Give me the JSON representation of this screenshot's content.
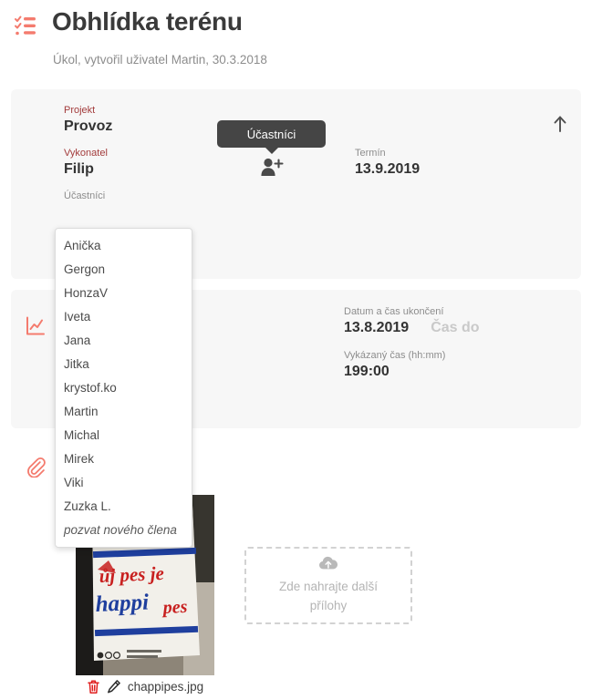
{
  "header": {
    "icon": "checklist-icon",
    "title": "Obhlídka terénu",
    "subtitle": "Úkol, vytvořil uživatel Martin, 30.3.2018"
  },
  "accent_color": "#f47b6e",
  "label_accent_color": "#a33c3c",
  "detail_card": {
    "rail_icon": "checklist-icon",
    "project": {
      "label": "Projekt",
      "value": "Provoz"
    },
    "assignee": {
      "label": "Vykonatel",
      "value": "Filip"
    },
    "participants": {
      "label": "Účastníci"
    },
    "deadline": {
      "label": "Termín",
      "value": "13.9.2019"
    },
    "add_participant_icon": "person-add-icon",
    "collapse_icon": "arrow-up-icon",
    "tooltip": "Účastníci"
  },
  "participants_dropdown": {
    "items": [
      "Anička",
      "Gergon",
      "HonzaV",
      "Iveta",
      "Jana",
      "Jitka",
      "krystof.ko",
      "Martin",
      "Michal",
      "Mirek",
      "Viki",
      "Zuzka L."
    ],
    "invite_label": "pozvat nového člena"
  },
  "time_card": {
    "rail_icon": "line-chart-icon",
    "end_datetime": {
      "label": "Datum a čas ukončení",
      "date_value": "13.8.2019",
      "time_placeholder": "Čas do"
    },
    "reported_time": {
      "label": "Vykázaný čas (hh:mm)",
      "value": "199:00"
    }
  },
  "files_card": {
    "rail_icon": "paperclip-icon",
    "attachment": {
      "filename": "chappipes.jpg",
      "delete_icon": "trash-icon",
      "edit_icon": "pencil-icon",
      "thumbnail_alt": "chappi dog food bag photo"
    },
    "dropzone": {
      "icon": "cloud-upload-icon",
      "text": "Zde nahrajte další přílohy"
    }
  }
}
